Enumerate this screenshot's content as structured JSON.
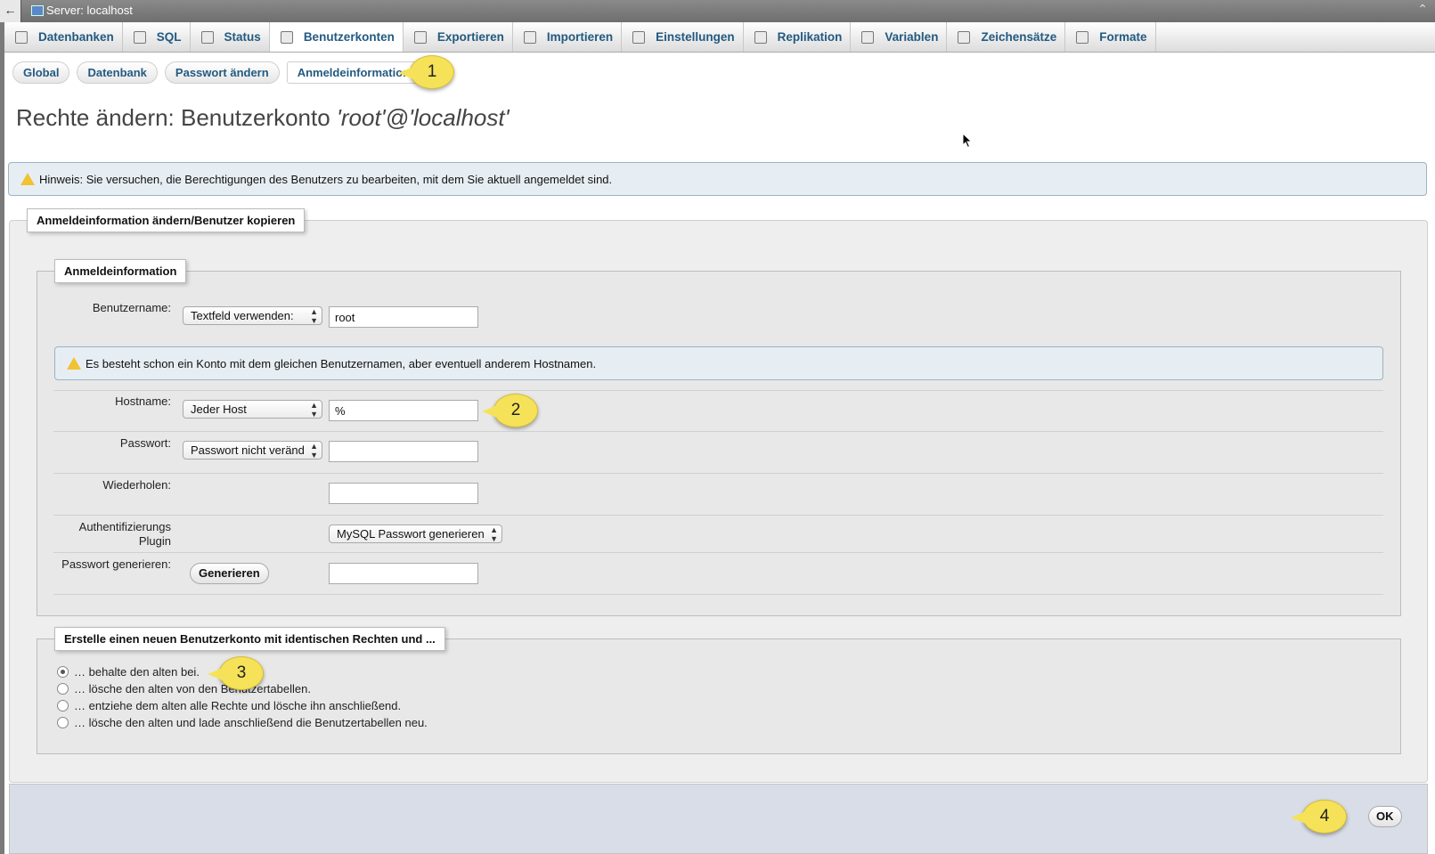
{
  "window": {
    "title": "Server: localhost",
    "back_glyph": "←",
    "collapse_glyph": "⌃"
  },
  "topnav": [
    {
      "label": "Datenbanken",
      "icon": "database-icon"
    },
    {
      "label": "SQL",
      "icon": "sql-icon"
    },
    {
      "label": "Status",
      "icon": "status-icon"
    },
    {
      "label": "Benutzerkonten",
      "icon": "user-accounts-icon",
      "active": true
    },
    {
      "label": "Exportieren",
      "icon": "export-icon"
    },
    {
      "label": "Importieren",
      "icon": "import-icon"
    },
    {
      "label": "Einstellungen",
      "icon": "wrench-icon"
    },
    {
      "label": "Replikation",
      "icon": "replication-icon"
    },
    {
      "label": "Variablen",
      "icon": "variables-icon"
    },
    {
      "label": "Zeichensätze",
      "icon": "charset-icon"
    },
    {
      "label": "Formate",
      "icon": "engines-icon"
    }
  ],
  "subnav": [
    {
      "label": "Global"
    },
    {
      "label": "Datenbank"
    },
    {
      "label": "Passwort ändern"
    },
    {
      "label": "Anmeldeinformation",
      "active": true
    }
  ],
  "page": {
    "title_prefix": "Rechte ändern: Benutzerkonto ",
    "title_user": "'root'@'localhost'",
    "notice": "Hinweis: Sie versuchen, die Berechtigungen des Benutzers zu bearbeiten, mit dem Sie aktuell angemeldet sind."
  },
  "login_section": {
    "legend": "Anmeldeinformation ändern/Benutzer kopieren",
    "inner_legend": "Anmeldeinformation",
    "username": {
      "label": "Benutzername:",
      "select": "Textfeld verwenden:",
      "value": "root"
    },
    "username_notice": "Es besteht schon ein Konto mit dem gleichen Benutzernamen, aber eventuell anderem Hostnamen.",
    "hostname": {
      "label": "Hostname:",
      "select": "Jeder Host",
      "value": "%"
    },
    "password": {
      "label": "Passwort:",
      "select": "Passwort nicht veränd",
      "value": ""
    },
    "repeat": {
      "label": "Wiederholen:",
      "value": ""
    },
    "auth_plugin": {
      "label_line1": "Authentifizierungs",
      "label_line2": "Plugin",
      "select": "MySQL Passwort generieren"
    },
    "generate": {
      "label": "Passwort generieren:",
      "button": "Generieren",
      "value": ""
    }
  },
  "copy_section": {
    "legend": "Erstelle einen neuen Benutzerkonto mit identischen Rechten und ...",
    "options": [
      {
        "label": "… behalte den alten bei.",
        "checked": true
      },
      {
        "label": "… lösche den alten von den Benutzertabellen.",
        "checked": false
      },
      {
        "label": "… entziehe dem alten alle Rechte und lösche ihn anschließend.",
        "checked": false
      },
      {
        "label": "… lösche den alten und lade anschließend die Benutzertabellen neu.",
        "checked": false
      }
    ]
  },
  "footer": {
    "ok_label": "OK"
  },
  "callouts": [
    "1",
    "2",
    "3",
    "4"
  ]
}
